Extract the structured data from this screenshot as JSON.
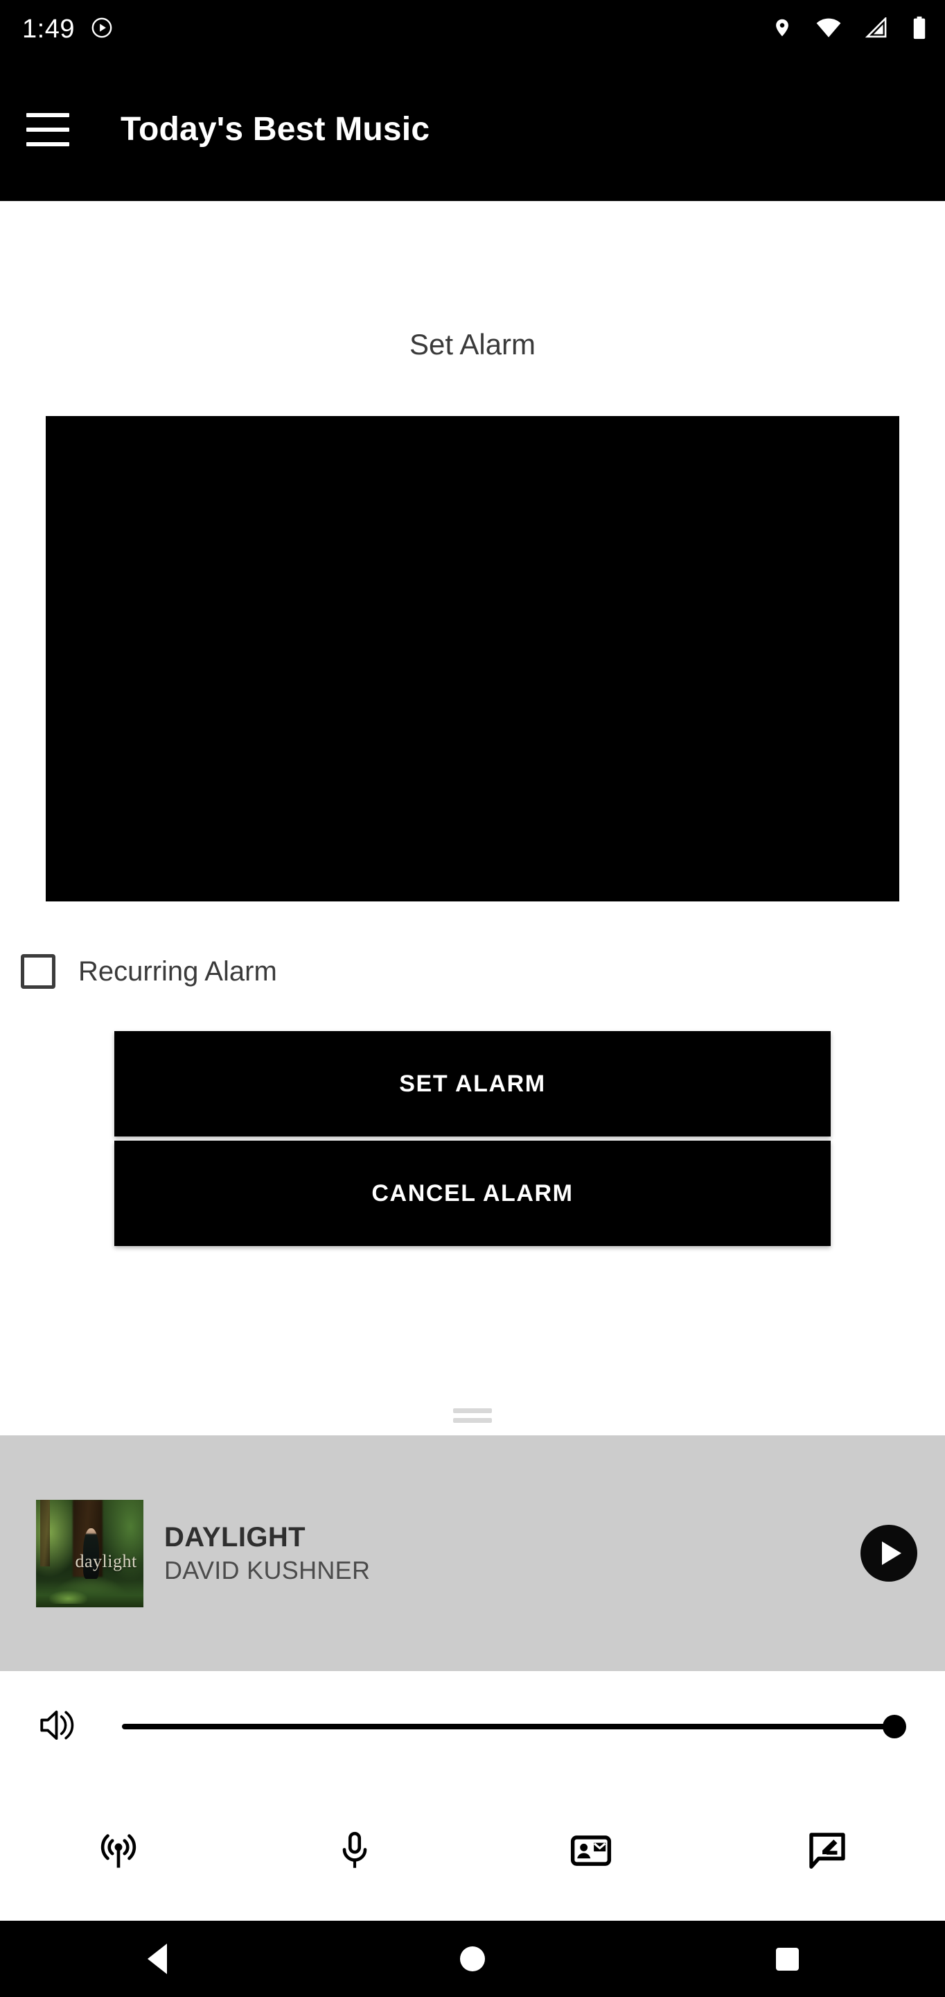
{
  "status_bar": {
    "time": "1:49",
    "left_icons": [
      "play-circle-icon"
    ],
    "right_icons": [
      "location-pin-icon",
      "wifi-icon",
      "cellular-signal-icon",
      "battery-icon"
    ]
  },
  "app_bar": {
    "menu_icon": "hamburger-menu-icon",
    "title": "Today's Best Music"
  },
  "main": {
    "section_title": "Set Alarm",
    "time_picker": {
      "name": "time-picker",
      "state": "blank"
    },
    "recurring": {
      "label": "Recurring Alarm",
      "checked": false
    },
    "buttons": {
      "set_alarm": "SET ALARM",
      "cancel_alarm": "CANCEL ALARM"
    },
    "drag_handle": "drag-handle"
  },
  "now_playing": {
    "title": "DAYLIGHT",
    "artist": "DAVID KUSHNER",
    "album_art_caption": "daylight",
    "play_button": "play-button",
    "state": "paused",
    "background_color": "#cccccc"
  },
  "volume": {
    "icon": "volume-up-icon",
    "level": 100
  },
  "toolbar": {
    "items": [
      {
        "icon": "broadcast-icon",
        "name": "toolbar-broadcast"
      },
      {
        "icon": "microphone-icon",
        "name": "toolbar-microphone"
      },
      {
        "icon": "contact-mail-icon",
        "name": "toolbar-contact-mail"
      },
      {
        "icon": "rate-review-icon",
        "name": "toolbar-rate-review"
      }
    ]
  },
  "nav_bar": {
    "back": "back-button",
    "home": "home-button",
    "recents": "recents-button"
  },
  "colors": {
    "app_bar": "#000000",
    "accent": "#000000",
    "now_playing_bg": "#cccccc",
    "text_primary": "#3a3a3a"
  }
}
